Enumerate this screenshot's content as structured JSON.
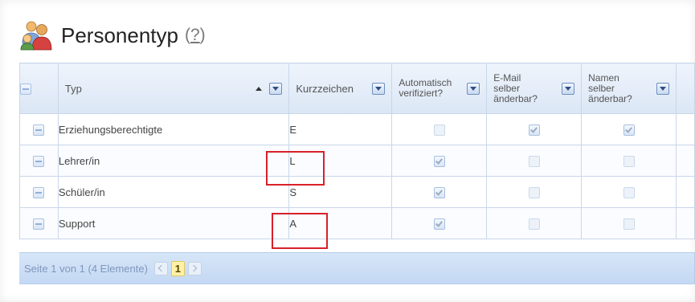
{
  "page": {
    "title": "Personentyp",
    "help": "?"
  },
  "table": {
    "headers": {
      "typ": "Typ",
      "kurzzeichen": "Kurzzeichen",
      "auto_line1": "Automatisch",
      "auto_line2": "verifiziert?",
      "email_line1": "E-Mail",
      "email_line2": "selber",
      "email_line3": "änderbar?",
      "namen_line1": "Namen",
      "namen_line2": "selber",
      "namen_line3": "änderbar?"
    },
    "rows": [
      {
        "typ": "Erziehungsberechtigte",
        "kurz": "E",
        "auto": false,
        "email": true,
        "namen": true
      },
      {
        "typ": "Lehrer/in",
        "kurz": "L",
        "auto": true,
        "email": false,
        "namen": false
      },
      {
        "typ": "Schüler/in",
        "kurz": "S",
        "auto": true,
        "email": false,
        "namen": false
      },
      {
        "typ": "Support",
        "kurz": "A",
        "auto": true,
        "email": false,
        "namen": false
      }
    ]
  },
  "pager": {
    "summary": "Seite 1 von 1 (4 Elemente)",
    "current_page": "1"
  },
  "colors": {
    "highlight_box": "#d8202a",
    "header_bg": "#dbe6f5",
    "pager_bg": "#c3d8f3"
  },
  "icons": {
    "title": "people-group-icon"
  }
}
